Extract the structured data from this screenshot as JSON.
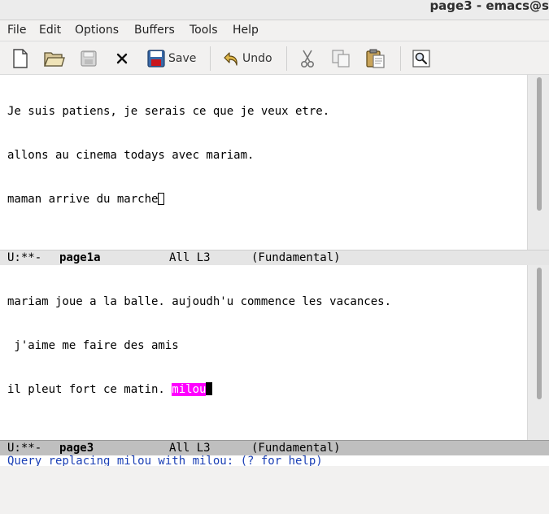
{
  "window": {
    "title": "page3 - emacs@s"
  },
  "menubar": {
    "items": [
      "File",
      "Edit",
      "Options",
      "Buffers",
      "Tools",
      "Help"
    ]
  },
  "toolbar": {
    "save_label": "Save",
    "undo_label": "Undo",
    "icons": [
      "new-file-icon",
      "open-folder-icon",
      "save-disk-icon",
      "close-icon",
      "save-icon",
      "undo-icon",
      "cut-icon",
      "copy-icon",
      "paste-icon",
      "search-icon"
    ]
  },
  "top_window": {
    "lines": [
      "Je suis patiens, je serais ce que je veux etre.",
      "allons au cinema todays avec mariam.",
      "maman arrive du marche"
    ],
    "modeline": {
      "status": "U:**-",
      "buffer_name": "page1a",
      "position": "All L3",
      "mode": "(Fundamental)"
    }
  },
  "bottom_window": {
    "lines": [
      "mariam joue a la balle. aujoudh'u commence les vacances.",
      " j'aime me faire des amis",
      "il pleut fort ce matin. "
    ],
    "highlighted_word": "milou",
    "modeline": {
      "status": "U:**-",
      "buffer_name": "page3",
      "position": "All L3",
      "mode": "(Fundamental)"
    }
  },
  "minibuffer": {
    "text": "Query replacing milou with milou: (? for help)"
  },
  "colors": {
    "highlight": "#ff00ff",
    "minibuffer_text": "#1a3fb5",
    "active_modeline": "#bfbfbf",
    "inactive_modeline": "#e5e5e5"
  }
}
